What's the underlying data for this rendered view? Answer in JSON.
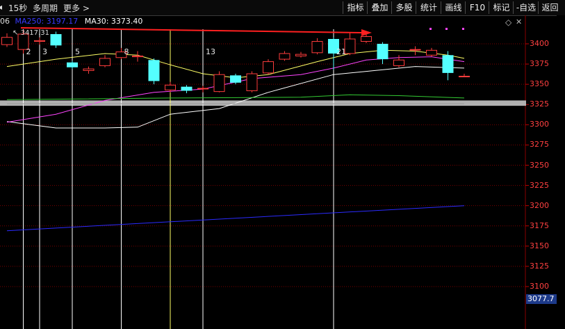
{
  "toolbar": {
    "period": "15秒",
    "multi_period": "多周期",
    "more": "更多 >",
    "buttons": [
      "指标",
      "叠加",
      "多股",
      "统计",
      "画线",
      "F10",
      "标记",
      "-自选",
      "返回"
    ]
  },
  "indicator_line": {
    "prefix": "06",
    "ma250": "MA250: 3197.17",
    "ma30": "MA30: 3373.40"
  },
  "high_label": "3417.31",
  "current_price": "3077.7",
  "y_axis": [
    "3400",
    "3375",
    "3350",
    "3325",
    "3300",
    "3275",
    "3250",
    "3225",
    "3200",
    "3175",
    "3150",
    "3125",
    "3100"
  ],
  "count_labels": [
    "2",
    "3",
    "5",
    "8",
    "13",
    "21"
  ],
  "colors": {
    "up": "#ff3c3c",
    "down": "#54ffff",
    "ma_white": "#ffffff",
    "ma_yellow": "#ffff66",
    "ma_magenta": "#ff44ff",
    "ma_green": "#33cc33",
    "ma250": "#2b2bff",
    "grid": "#7a0000",
    "support_band": "#b0b0b0"
  },
  "chart_data": {
    "type": "candlestick",
    "y_range": [
      3077.7,
      3436
    ],
    "candles": [
      {
        "o": 3399,
        "c": 3408,
        "h": 3413,
        "l": 3396
      },
      {
        "o": 3393,
        "c": 3412,
        "h": 3417.31,
        "l": 3388
      },
      {
        "o": 3403,
        "c": 3404,
        "h": 3408,
        "l": 3399
      },
      {
        "o": 3412,
        "c": 3398,
        "h": 3415,
        "l": 3395
      },
      {
        "o": 3377,
        "c": 3371,
        "h": 3379,
        "l": 3369
      },
      {
        "o": 3367,
        "c": 3369,
        "h": 3372,
        "l": 3363
      },
      {
        "o": 3373,
        "c": 3382,
        "h": 3386,
        "l": 3371
      },
      {
        "o": 3383,
        "c": 3390,
        "h": 3395,
        "l": 3381
      },
      {
        "o": 3384,
        "c": 3385,
        "h": 3391,
        "l": 3378
      },
      {
        "o": 3380,
        "c": 3354,
        "h": 3382,
        "l": 3350
      },
      {
        "o": 3343,
        "c": 3349,
        "h": 3353,
        "l": 3340
      },
      {
        "o": 3347,
        "c": 3342,
        "h": 3349,
        "l": 3339
      },
      {
        "o": 3345,
        "c": 3345,
        "h": 3348,
        "l": 3340
      },
      {
        "o": 3341,
        "c": 3362,
        "h": 3366,
        "l": 3340
      },
      {
        "o": 3361,
        "c": 3352,
        "h": 3363,
        "l": 3350
      },
      {
        "o": 3342,
        "c": 3363,
        "h": 3366,
        "l": 3340
      },
      {
        "o": 3364,
        "c": 3378,
        "h": 3381,
        "l": 3362
      },
      {
        "o": 3381,
        "c": 3388,
        "h": 3391,
        "l": 3379
      },
      {
        "o": 3385,
        "c": 3387,
        "h": 3390,
        "l": 3383
      },
      {
        "o": 3389,
        "c": 3403,
        "h": 3407,
        "l": 3387
      },
      {
        "o": 3406,
        "c": 3388,
        "h": 3408,
        "l": 3368
      },
      {
        "o": 3388,
        "c": 3406,
        "h": 3414,
        "l": 3386
      },
      {
        "o": 3403,
        "c": 3409,
        "h": 3412,
        "l": 3401
      },
      {
        "o": 3400,
        "c": 3381,
        "h": 3402,
        "l": 3375
      },
      {
        "o": 3373,
        "c": 3380,
        "h": 3386,
        "l": 3371
      },
      {
        "o": 3393,
        "c": 3393,
        "h": 3397,
        "l": 3386
      },
      {
        "o": 3386,
        "c": 3392,
        "h": 3395,
        "l": 3384
      },
      {
        "o": 3386,
        "c": 3364,
        "h": 3391,
        "l": 3355
      },
      {
        "o": 3360,
        "c": 3360,
        "h": 3363,
        "l": 3360
      }
    ],
    "ma_series": [
      {
        "name": "MA30",
        "color": "#ffffff",
        "points": [
          [
            0,
            3304
          ],
          [
            3,
            3296
          ],
          [
            6,
            3296
          ],
          [
            8,
            3297
          ],
          [
            10,
            3313
          ],
          [
            13,
            3320
          ],
          [
            16,
            3340
          ],
          [
            20,
            3362
          ],
          [
            22,
            3366
          ],
          [
            25,
            3372
          ],
          [
            28,
            3370
          ]
        ]
      },
      {
        "name": "",
        "color": "#ffff66",
        "points": [
          [
            0,
            3372
          ],
          [
            3,
            3381
          ],
          [
            6,
            3388
          ],
          [
            8,
            3386
          ],
          [
            10,
            3374
          ],
          [
            12,
            3363
          ],
          [
            14,
            3358
          ],
          [
            16,
            3362
          ],
          [
            19,
            3378
          ],
          [
            21,
            3388
          ],
          [
            23,
            3392
          ],
          [
            25,
            3391
          ],
          [
            27,
            3386
          ],
          [
            28,
            3382
          ]
        ]
      },
      {
        "name": "",
        "color": "#ff44ff",
        "points": [
          [
            0,
            3303
          ],
          [
            3,
            3313
          ],
          [
            6,
            3330
          ],
          [
            9,
            3340
          ],
          [
            12,
            3344
          ],
          [
            15,
            3357
          ],
          [
            18,
            3362
          ],
          [
            20,
            3370
          ],
          [
            22,
            3380
          ],
          [
            24,
            3383
          ],
          [
            26,
            3384
          ],
          [
            28,
            3378
          ]
        ]
      },
      {
        "name": "",
        "color": "#33cc33",
        "points": [
          [
            0,
            3331
          ],
          [
            10,
            3333
          ],
          [
            18,
            3334
          ],
          [
            21,
            3337
          ],
          [
            24,
            3336
          ],
          [
            28,
            3333
          ]
        ]
      },
      {
        "name": "",
        "color": "#999999",
        "points": [
          [
            0,
            3326
          ],
          [
            28,
            3326
          ]
        ]
      },
      {
        "name": "MA250",
        "color": "#2b2bff",
        "points": [
          [
            0,
            3169
          ],
          [
            28,
            3200
          ]
        ]
      }
    ],
    "support_band": [
      3323.4,
      3330.0
    ],
    "fib_count_indexes": [
      1,
      2,
      4,
      7,
      12,
      20
    ]
  }
}
